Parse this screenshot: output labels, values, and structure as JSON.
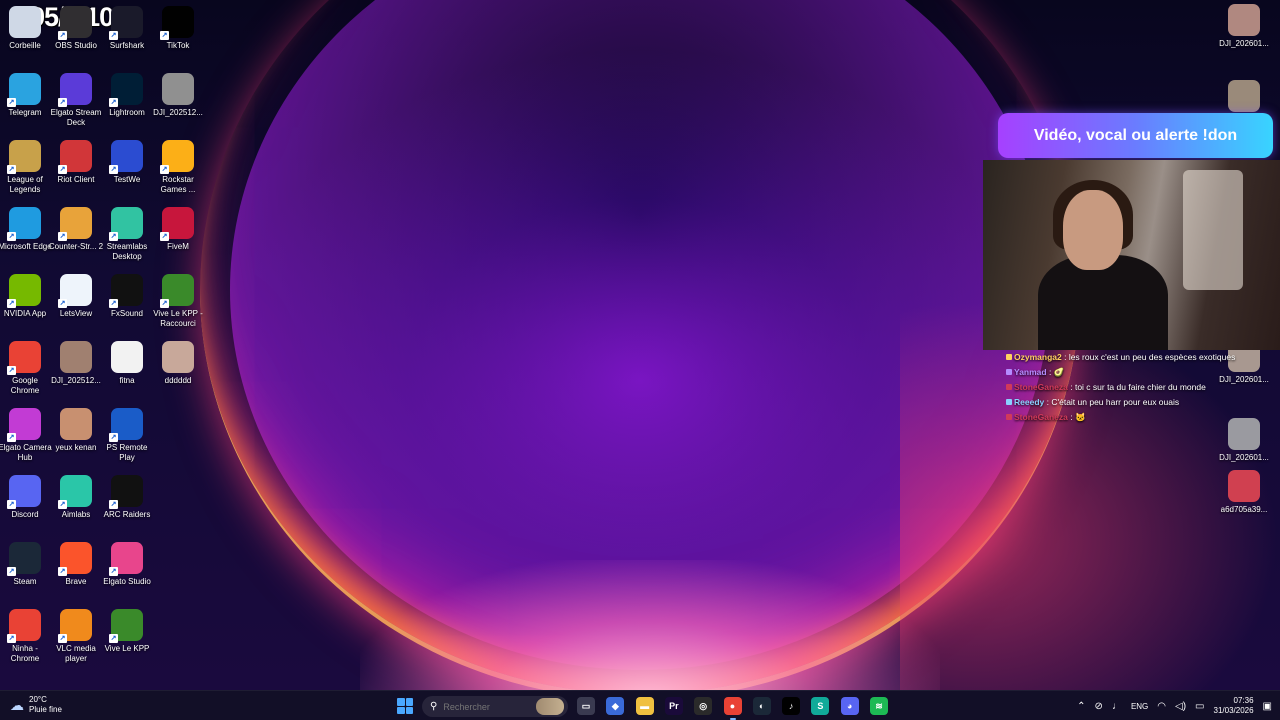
{
  "desktop": {
    "icons_col1": [
      {
        "label": "Corbeille",
        "icon": "recycle-bin-icon",
        "color": "#cfd8e6"
      },
      {
        "label": "Telegram",
        "icon": "telegram-icon",
        "color": "#2aa3e0"
      },
      {
        "label": "League of Legends",
        "icon": "league-of-legends-icon",
        "color": "#c8a14a"
      },
      {
        "label": "Microsoft Edge",
        "icon": "edge-icon",
        "color": "#1f9be0"
      },
      {
        "label": "NVIDIA App",
        "icon": "nvidia-icon",
        "color": "#76b900"
      },
      {
        "label": "Google Chrome",
        "icon": "chrome-icon",
        "color": "#e94235"
      },
      {
        "label": "Elgato Camera Hub",
        "icon": "elgato-camera-hub-icon",
        "color": "#c23bd4"
      },
      {
        "label": "Discord",
        "icon": "discord-icon",
        "color": "#5865f2"
      },
      {
        "label": "Steam",
        "icon": "steam-icon",
        "color": "#1b2838"
      },
      {
        "label": "Ninha - Chrome",
        "icon": "chrome-profile-icon",
        "color": "#e94235"
      }
    ],
    "icons_col2": [
      {
        "label": "OBS Studio",
        "icon": "obs-icon",
        "color": "#302e31"
      },
      {
        "label": "Elgato Stream Deck",
        "icon": "stream-deck-icon",
        "color": "#5b3bd8"
      },
      {
        "label": "Riot Client",
        "icon": "riot-icon",
        "color": "#d13639"
      },
      {
        "label": "Counter-Str... 2",
        "icon": "counter-strike-icon",
        "color": "#e8a33a"
      },
      {
        "label": "LetsView",
        "icon": "letsview-icon",
        "color": "#eef4fb"
      },
      {
        "label": "DJI_202512...",
        "icon": "video-thumbnail-icon",
        "color": "#a08070"
      },
      {
        "label": "yeux kenan",
        "icon": "image-thumbnail-icon",
        "color": "#c89070"
      },
      {
        "label": "Aimlabs",
        "icon": "aimlabs-icon",
        "color": "#2ac6a8"
      },
      {
        "label": "Brave",
        "icon": "brave-icon",
        "color": "#fb542b"
      },
      {
        "label": "VLC media player",
        "icon": "vlc-icon",
        "color": "#f08a1c"
      }
    ],
    "icons_col3": [
      {
        "label": "Surfshark",
        "icon": "surfshark-icon",
        "color": "#1a1a2a"
      },
      {
        "label": "Lightroom",
        "icon": "lightroom-icon",
        "color": "#001e36"
      },
      {
        "label": "TestWe",
        "icon": "testwe-icon",
        "color": "#2b4cd1"
      },
      {
        "label": "Streamlabs Desktop",
        "icon": "streamlabs-icon",
        "color": "#31c3a2"
      },
      {
        "label": "FxSound",
        "icon": "fxsound-icon",
        "color": "#111111"
      },
      {
        "label": "fitna",
        "icon": "text-file-icon",
        "color": "#f2f2f2"
      },
      {
        "label": "PS Remote Play",
        "icon": "ps-remote-play-icon",
        "color": "#1a5cc8"
      },
      {
        "label": "ARC Raiders",
        "icon": "arc-raiders-icon",
        "color": "#111111"
      },
      {
        "label": "Elgato Studio",
        "icon": "elgato-studio-icon",
        "color": "#e8458c"
      },
      {
        "label": "Vive Le KPP",
        "icon": "kpp-icon",
        "color": "#3a8a2a"
      }
    ],
    "icons_col4": [
      {
        "label": "TikTok",
        "icon": "tiktok-icon",
        "color": "#010101"
      },
      {
        "label": "DJI_202512...",
        "icon": "video-thumbnail-icon",
        "color": "#909090"
      },
      {
        "label": "Rockstar Games ...",
        "icon": "rockstar-icon",
        "color": "#fcaf17"
      },
      {
        "label": "FiveM",
        "icon": "fivem-icon",
        "color": "#c7163c"
      },
      {
        "label": "Vive Le KPP - Raccourci",
        "icon": "kpp-icon",
        "color": "#3a8a2a"
      },
      {
        "label": "dddddd",
        "icon": "image-thumbnail-icon",
        "color": "#c8a89a"
      }
    ],
    "icons_right": [
      {
        "label": "DJI_202601...",
        "icon": "video-thumbnail-icon",
        "color": "#b08880"
      },
      {
        "label": "DJI_202601...",
        "icon": "video-thumbnail-icon",
        "color": "#9a8a7a"
      },
      {
        "label": "DJI_202601...",
        "icon": "video-thumbnail-icon",
        "color": "#a89890"
      },
      {
        "label": "DJI_202601...",
        "icon": "video-thumbnail-icon",
        "color": "#9a9aa0"
      },
      {
        "label": "a6d705a39...",
        "icon": "image-thumbnail-icon",
        "color": "#d04050"
      }
    ],
    "obs_counter": "595/ 610"
  },
  "overlay": {
    "alert_text": "Vidéo, vocal ou alerte !don",
    "chat": [
      {
        "user": "Ozymanga2",
        "message": "les roux c'est un peu des espèces exotiques",
        "user_color": "#ffd060"
      },
      {
        "user": "Yanmad",
        "message": "🥑",
        "user_color": "#b48cff"
      },
      {
        "user": "StoneGaneza",
        "message": "toi c sur ta du faire chier du monde",
        "user_color": "#d03a5a"
      },
      {
        "user": "Reeedy",
        "message": "C'était un peu harr pour eux ouais",
        "user_color": "#8ad0ff"
      },
      {
        "user": "StoneGaneza",
        "message": "🐱",
        "user_color": "#d03a5a"
      }
    ]
  },
  "taskbar": {
    "weather_temp": "20°C",
    "weather_desc": "Pluie fine",
    "search_placeholder": "Rechercher",
    "apps": [
      {
        "name": "task-view-icon",
        "glyph": "▭",
        "color": "#3a3a50"
      },
      {
        "name": "copilot-icon",
        "glyph": "◆",
        "color": "#3a6ad8"
      },
      {
        "name": "file-explorer-icon",
        "glyph": "▬",
        "color": "#f0c040"
      },
      {
        "name": "premiere-pro-icon",
        "glyph": "Pr",
        "color": "#1a0a3a"
      },
      {
        "name": "obs-icon",
        "glyph": "◎",
        "color": "#2a2a2a"
      },
      {
        "name": "chrome-icon",
        "glyph": "●",
        "color": "#e94235"
      },
      {
        "name": "steam-icon",
        "glyph": "◐",
        "color": "#1b2838"
      },
      {
        "name": "tiktok-icon",
        "glyph": "♪",
        "color": "#010101"
      },
      {
        "name": "surfshark-icon",
        "glyph": "S",
        "color": "#11aa99"
      },
      {
        "name": "discord-icon",
        "glyph": "◕",
        "color": "#5865f2"
      },
      {
        "name": "spotify-icon",
        "glyph": "≋",
        "color": "#1db954"
      }
    ],
    "lang": "ENG",
    "time": "07:36",
    "date": "31/03/2026"
  }
}
